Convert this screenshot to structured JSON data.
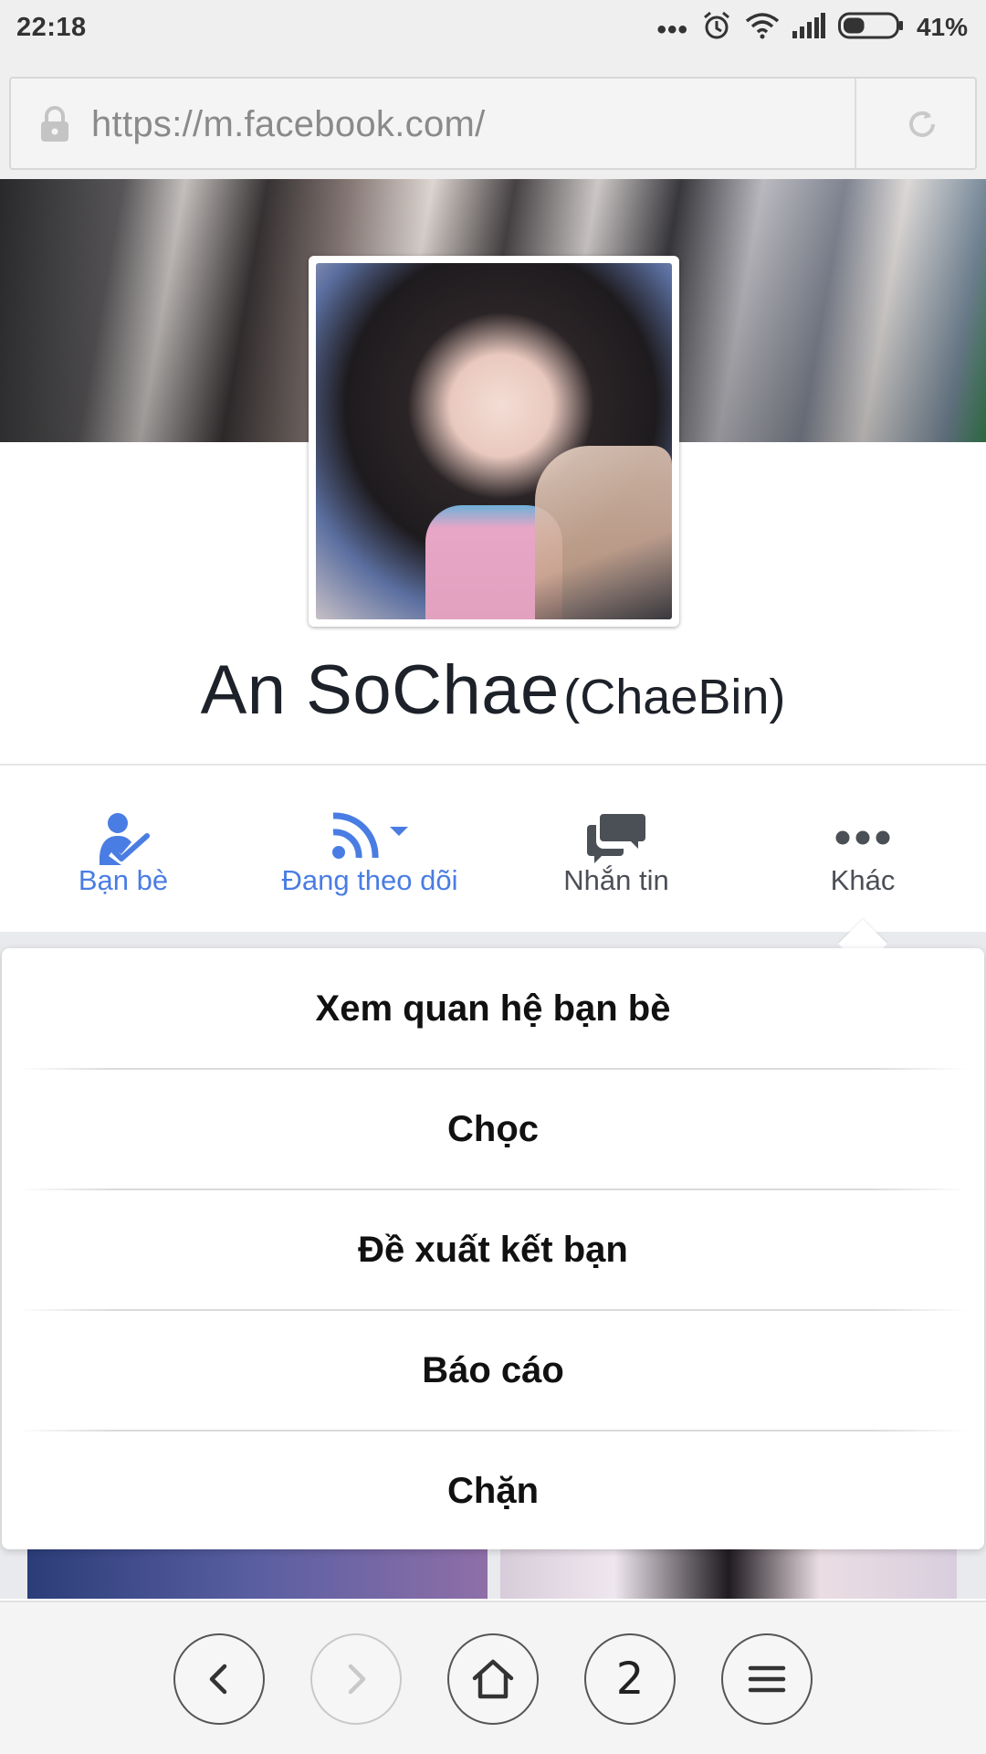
{
  "status_bar": {
    "time": "22:18",
    "overflow_dots": "•••",
    "battery_text": "41%",
    "battery_level": 0.41,
    "icons": [
      "alarm-icon",
      "wifi-icon",
      "signal-icon",
      "battery-icon"
    ]
  },
  "browser": {
    "url": "https://m.facebook.com/",
    "tab_count": "2"
  },
  "profile": {
    "name": "An SoChae",
    "alternate_name": "(ChaeBin)"
  },
  "actions": [
    {
      "label": "Bạn bè",
      "icon": "friends-check-icon",
      "color": "#4a7de3"
    },
    {
      "label": "Đang theo dõi",
      "icon": "rss-follow-icon",
      "color": "#4a7de3"
    },
    {
      "label": "Nhắn tin",
      "icon": "message-bubbles-icon",
      "color": "#4b4f56"
    },
    {
      "label": "Khác",
      "icon": "more-dots-icon",
      "color": "#4b4f56"
    }
  ],
  "menu": {
    "items": [
      {
        "label": "Xem quan hệ bạn bè"
      },
      {
        "label": "Chọc"
      },
      {
        "label": "Đề xuất kết bạn"
      },
      {
        "label": "Báo cáo"
      },
      {
        "label": "Chặn"
      }
    ]
  },
  "colors": {
    "accent_blue": "#4a7de3",
    "icon_gray": "#4b4f56",
    "text_dark": "#1d2129"
  }
}
